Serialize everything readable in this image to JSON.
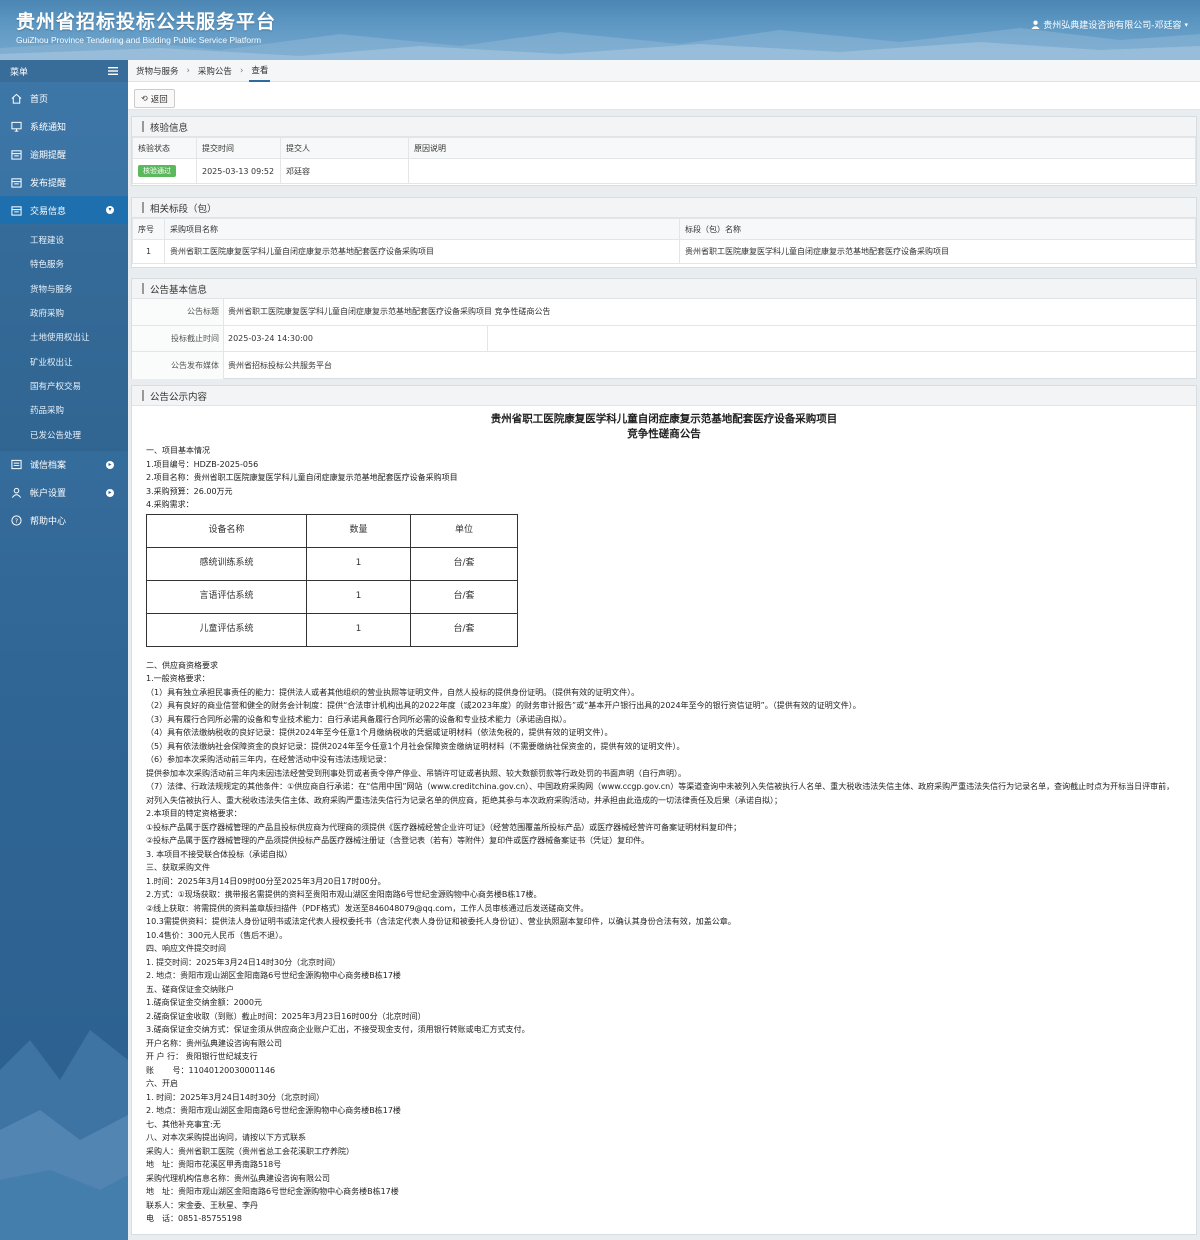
{
  "header": {
    "title": "贵州省招标投标公共服务平台",
    "subtitle": "GuiZhou Province Tendering and Bidding Public Service Platform",
    "user": "贵州弘典建设咨询有限公司-邓廷容"
  },
  "sidebar": {
    "menu_label": "菜单",
    "items": [
      {
        "label": "首页",
        "icon": "home-icon"
      },
      {
        "label": "系统通知",
        "icon": "monitor-icon"
      },
      {
        "label": "逾期提醒",
        "icon": "calendar-icon"
      },
      {
        "label": "发布提醒",
        "icon": "calendar-icon"
      },
      {
        "label": "交易信息",
        "icon": "calendar-icon",
        "active": true
      }
    ],
    "subitems": [
      "工程建设",
      "特色服务",
      "货物与服务",
      "政府采购",
      "土地使用权出让",
      "矿业权出让",
      "国有产权交易",
      "药品采购",
      "已发公告处理"
    ],
    "bottom_items": [
      {
        "label": "诚信档案",
        "icon": "list-icon"
      },
      {
        "label": "帐户设置",
        "icon": "user-icon"
      },
      {
        "label": "帮助中心",
        "icon": "help-icon"
      }
    ]
  },
  "breadcrumb": [
    "货物与服务",
    "采购公告",
    "查看"
  ],
  "back_label": "返回",
  "verify": {
    "title": "核验信息",
    "headers": [
      "核验状态",
      "提交时间",
      "提交人",
      "原因说明"
    ],
    "status": "核验通过",
    "time": "2025-03-13 09:52",
    "person": "邓廷容",
    "reason": ""
  },
  "sections": {
    "title": "相关标段（包）",
    "headers": [
      "序号",
      "采购项目名称",
      "标段（包）名称"
    ],
    "rows": [
      [
        "1",
        "贵州省职工医院康复医学科儿童自闭症康复示范基地配套医疗设备采购项目",
        "贵州省职工医院康复医学科儿童自闭症康复示范基地配套医疗设备采购项目"
      ]
    ]
  },
  "basic": {
    "title": "公告基本信息",
    "rows": [
      {
        "k": "公告标题",
        "v": "贵州省职工医院康复医学科儿童自闭症康复示范基地配套医疗设备采购项目 竞争性磋商公告"
      },
      {
        "k": "投标截止时间",
        "v": "2025-03-24 14:30:00"
      },
      {
        "k": "公告发布媒体",
        "v": "贵州省招标投标公共服务平台"
      }
    ]
  },
  "content": {
    "title": "公告公示内容",
    "doc_title1": "贵州省职工医院康复医学科儿童自闭症康复示范基地配套医疗设备采购项目",
    "doc_title2": "竞争性磋商公告",
    "pre": [
      "一、项目基本情况",
      "1.项目编号：HDZB-2025-056",
      "2.项目名称：贵州省职工医院康复医学科儿童自闭症康复示范基地配套医疗设备采购项目",
      "3.采购预算：26.00万元",
      "4.采购需求："
    ],
    "table_headers": [
      "设备名称",
      "数量",
      "单位"
    ],
    "table_rows": [
      [
        "感统训练系统",
        "1",
        "台/套"
      ],
      [
        "言语评估系统",
        "1",
        "台/套"
      ],
      [
        "儿童评估系统",
        "1",
        "台/套"
      ]
    ],
    "post": [
      "二、供应商资格要求",
      "1.一般资格要求：",
      "（1）具有独立承担民事责任的能力：提供法人或者其他组织的营业执照等证明文件，自然人投标的提供身份证明。（提供有效的证明文件）。",
      "（2）具有良好的商业信誉和健全的财务会计制度：提供“合法审计机构出具的2022年度（或2023年度）的财务审计报告”或“基本开户银行出具的2024年至今的银行资信证明”。（提供有效的证明文件）。",
      "（3）具有履行合同所必需的设备和专业技术能力：自行承诺具备履行合同所必需的设备和专业技术能力（承诺函自拟）。",
      "（4）具有依法缴纳税收的良好记录：提供2024年至今任意1个月缴纳税收的凭据或证明材料（依法免税的，提供有效的证明文件）。",
      "（5）具有依法缴纳社会保障资金的良好记录：提供2024年至今任意1个月社会保障资金缴纳证明材料（不需要缴纳社保资金的，提供有效的证明文件）。",
      "（6）参加本次采购活动前三年内，在经营活动中没有违法违规记录：",
      "提供参加本次采购活动前三年内未因违法经营受到刑事处罚或者责令停产停业、吊销许可证或者执照、较大数额罚款等行政处罚的书面声明（自行声明）。",
      "（7）法律、行政法规规定的其他条件：①供应商自行承诺：在“信用中国”网站（www.creditchina.gov.cn）、中国政府采购网（www.ccgp.gov.cn）等渠道查询中未被列入失信被执行人名单、重大税收违法失信主体、政府采购严重违法失信行为记录名单，查询截止时点为开标当日评审前，对列入失信被执行人、重大税收违法失信主体、政府采购严重违法失信行为记录名单的供应商，拒绝其参与本次政府采购活动，并承担由此造成的一切法律责任及后果（承诺自拟）；",
      "2.本项目的特定资格要求：",
      "①投标产品属于医疗器械管理的产品且投标供应商为代理商的须提供《医疗器械经营企业许可证》（经营范围覆盖所投标产品）或医疗器械经营许可备案证明材料复印件；",
      "②投标产品属于医疗器械管理的产品须提供投标产品医疗器械注册证（含登记表（若有）等附件）复印件或医疗器械备案证书（凭证）复印件。",
      "3. 本项目不接受联合体投标（承诺自拟）",
      "三、获取采购文件",
      "1.时间：2025年3月14日09时00分至2025年3月20日17时00分。",
      "2.方式：①现场获取：携带报名需提供的资料至贵阳市观山湖区金阳南路6号世纪金源购物中心商务楼B栋17楼。",
      "②线上获取：将需提供的资料盖章版扫描件（PDF格式）发送至846048079@qq.com，工作人员审核通过后发送磋商文件。",
      "10.3需提供资料：提供法人身份证明书或法定代表人授权委托书（含法定代表人身份证和被委托人身份证）、营业执照副本复印件，以确认其身份合法有效，加盖公章。",
      "10.4售价：300元人民币（售后不退）。",
      "四、响应文件提交时间",
      "1. 提交时间：2025年3月24日14时30分（北京时间）",
      "2. 地点：贵阳市观山湖区金阳南路6号世纪金源购物中心商务楼B栋17楼",
      "五、磋商保证金交纳账户",
      "1.磋商保证金交纳金额：2000元",
      "2.磋商保证金收取（到账）截止时间：2025年3月23日16时00分（北京时间）",
      "3.磋商保证金交纳方式：保证金须从供应商企业账户汇出，不接受现金支付，须用银行转账或电汇方式支付。",
      "开户名称：贵州弘典建设咨询有限公司",
      "开 户 行： 贵阳银行世纪城支行",
      "账　　 号：11040120030001146",
      "六、开启",
      "1. 时间：2025年3月24日14时30分（北京时间）",
      "2. 地点：贵阳市观山湖区金阳南路6号世纪金源购物中心商务楼B栋17楼",
      "七、其他补充事宜:无",
      "八、对本次采购提出询问，请按以下方式联系",
      "采购人：贵州省职工医院（贵州省总工会花溪职工疗养院）",
      "地　址：贵阳市花溪区甲秀南路518号",
      "采购代理机构信息名称：贵州弘典建设咨询有限公司",
      "地　址：贵阳市观山湖区金阳南路6号世纪金源购物中心商务楼B栋17楼",
      "联系人：宋金委、王秋星、李丹",
      "电　话：0851-85755198"
    ]
  }
}
